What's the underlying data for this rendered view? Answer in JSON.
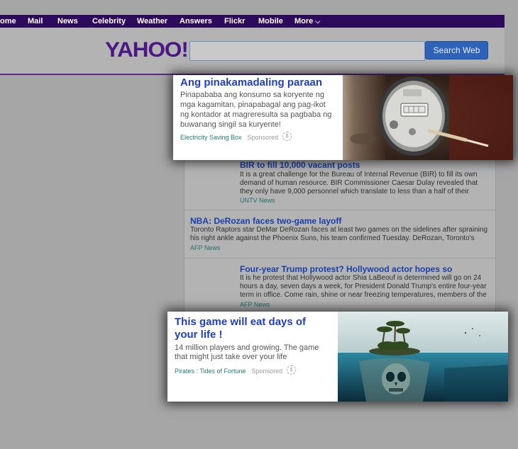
{
  "nav": {
    "items": [
      {
        "label": "ome"
      },
      {
        "label": "Mail"
      },
      {
        "label": "News"
      },
      {
        "label": "Celebrity"
      },
      {
        "label": "Weather"
      },
      {
        "label": "Answers"
      },
      {
        "label": "Flickr"
      },
      {
        "label": "Mobile"
      },
      {
        "label": "More"
      }
    ]
  },
  "header": {
    "logo": "YAHOO!",
    "search_placeholder": "",
    "search_button": "Search Web"
  },
  "feed": {
    "items": [
      {
        "title": "BIR to fill 10,000 vacant posts",
        "body": "It is a great challenge for the Bureau of Internal Revenue (BIR) to fill its own demand of human resource. BIR Commissioner Caesar Dulay revealed that they only have 9,000 personnel which translate to less than a half of their",
        "source": "UNTV News"
      },
      {
        "title": "NBA: DeRozan faces two-game layoff",
        "body": "Toronto Raptors star DeMar DeRozan faces at least two games on the sidelines after spraining his right ankle against the Phoenix Suns, his team confirmed Tuesday. DeRozan, Toronto's",
        "source": "AFP News"
      },
      {
        "title": "Four-year Trump protest? Hollywood actor hopes so",
        "body": "It is he protest that Hollywood actor Shia LaBeouf is determined will go on 24 hours a day, seven days a week, for President Donald Trump's entire four-year term in office. Come rain, shine or near freezing temperatures, members of the",
        "source": "AFP News"
      }
    ]
  },
  "ads": [
    {
      "title": "Ang pinakamadaling paraan",
      "description": "Pinapababa ang konsumo sa koryente ng mga kagamitan, pinapabagal ang pag-ikot ng kontador at magreresulta sa pagbaba ng buwanang singil sa kuryente!",
      "source": "Electricity Saving Box",
      "sponsored": "Sponsored"
    },
    {
      "title": "This game will eat days of your life !",
      "description": "14 million players and growing. The game that might just take over your life",
      "source": "Pirates : Tides of Fortune",
      "sponsored": "Sponsored"
    }
  ],
  "colors": {
    "nav_bg": "#2d0a5c",
    "logo": "#4c1784",
    "link": "#1f3fc4",
    "source": "#1f7a75",
    "button": "#2f63b8"
  }
}
